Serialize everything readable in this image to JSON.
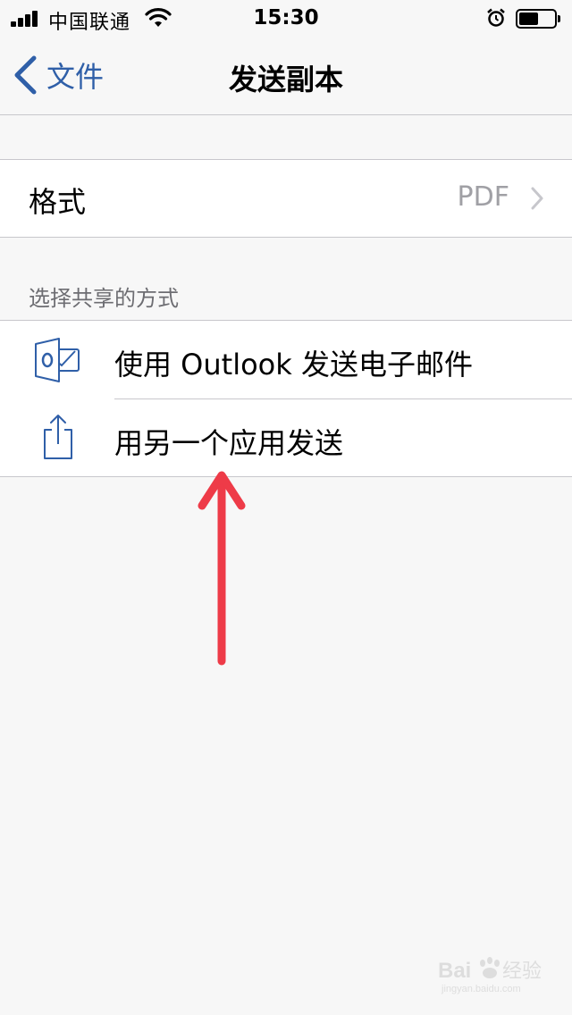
{
  "status_bar": {
    "carrier": "中国联通",
    "time": "15:30",
    "signal_bars": 4,
    "battery_level": 0.55
  },
  "nav": {
    "back_label": "文件",
    "title": "发送副本"
  },
  "format_row": {
    "label": "格式",
    "value": "PDF"
  },
  "share_section": {
    "header": "选择共享的方式",
    "items": [
      {
        "label": "使用 Outlook 发送电子邮件",
        "icon": "outlook-icon"
      },
      {
        "label": "用另一个应用发送",
        "icon": "share-icon"
      }
    ]
  },
  "colors": {
    "accent": "#2f5fa8",
    "annotation_arrow": "#ee3b48",
    "background": "#f7f7f7",
    "separator": "#c8c7cc"
  },
  "watermark": {
    "text": "Baidu经验",
    "subtext": "jingyan.baidu.com"
  }
}
